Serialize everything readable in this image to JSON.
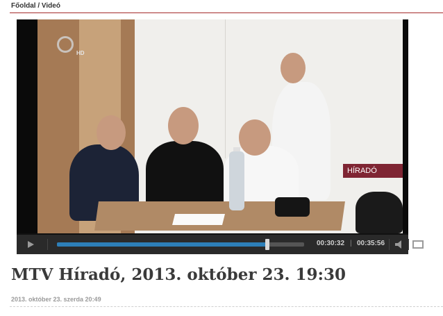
{
  "breadcrumb": {
    "home": "Főoldal",
    "separator": " / ",
    "current": "Videó"
  },
  "player": {
    "overlay_badge": "HÍRADÓ",
    "channel_hd": "HD",
    "current_time": "00:30:32",
    "separator": "|",
    "duration": "00:35:56",
    "progress": 0.85,
    "accent_color": "#2d7fb8"
  },
  "article": {
    "title": "MTV Híradó, 2013. október 23. 19:30",
    "date": "2013. október 23. szerda 20:49"
  },
  "icons": {
    "play": "play-icon",
    "volume": "volume-icon",
    "fullscreen": "fullscreen-icon"
  },
  "colors": {
    "rule": "#a52a2a",
    "title": "#3a3a3a"
  }
}
